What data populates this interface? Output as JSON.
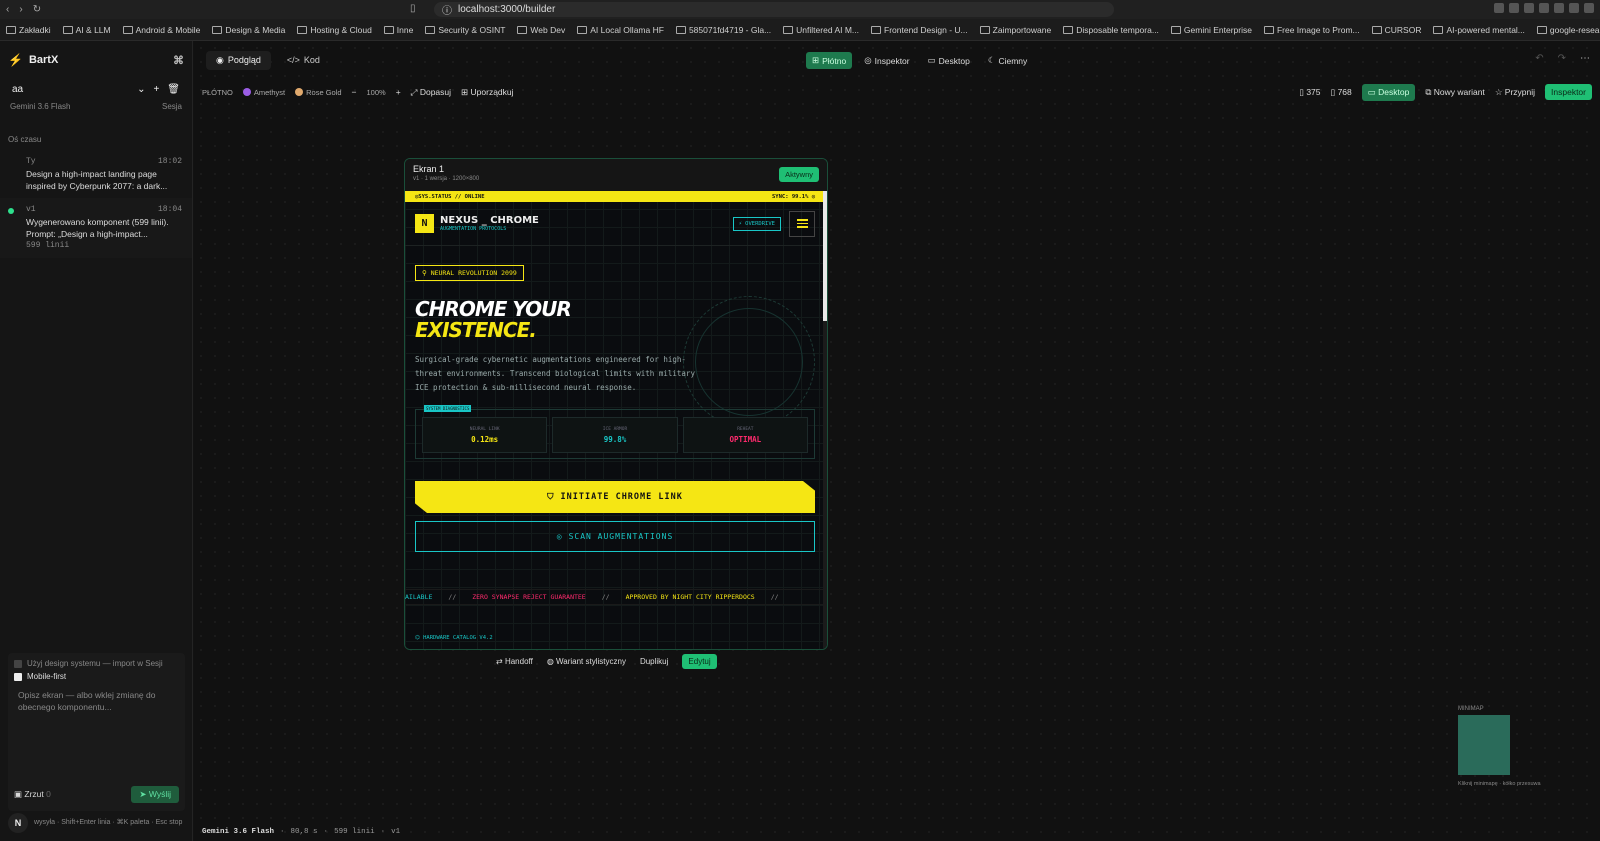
{
  "browser": {
    "url": "localhost:3000/builder",
    "bookmarks": [
      "Zakładki",
      "AI & LLM",
      "Android & Mobile",
      "Design & Media",
      "Hosting & Cloud",
      "Inne",
      "Security & OSINT",
      "Web Dev",
      "AI Local Ollama HF",
      "585071fd4719 - Gla...",
      "Unfiltered AI M...",
      "Frontend Design - U...",
      "Zaimportowane",
      "Disposable tempora...",
      "Gemini Enterprise",
      "Free Image to Prom...",
      "CURSOR",
      "AI-powered mental...",
      "google-research-da..."
    ]
  },
  "sidebar": {
    "app_name": "BartX",
    "cmd_symbol": "⌘",
    "session_value": "aa",
    "model": "Gemini 3.6 Flash",
    "session_label": "Sesja",
    "timeline_title": "Oś czasu",
    "timeline": [
      {
        "who": "Ty",
        "time": "18:02",
        "text": "Design a high-impact landing page inspired by Cyberpunk 2077: a dark..."
      },
      {
        "who": "v1",
        "time": "18:04",
        "text": "Wygenerowano komponent (599 linii). Prompt: „Design a high-impact...",
        "meta": "599 linii"
      }
    ],
    "use_design_system": "Użyj design systemu — import w Sesji",
    "mobile_first": "Mobile-first",
    "prompt_placeholder": "Opisz ekran — albo wklej zmianę do obecnego komponentu...",
    "snapshot_label": "Zrzut",
    "snapshot_count": "0",
    "send_label": "Wyślij",
    "footer_hint": "wysyła · Shift+Enter linia · ⌘K paleta · Esc stop",
    "avatar_letter": "N"
  },
  "topbar": {
    "tab_preview": "Podgląd",
    "tab_code": "Kod",
    "canvas": "Płótno",
    "inspector": "Inspektor",
    "desktop": "Desktop",
    "dark": "Ciemny"
  },
  "toolbar": {
    "canvas_label": "PŁÓTNO",
    "theme1": "Amethyst",
    "theme1_color": "#9b5de5",
    "theme2": "Rose Gold",
    "theme2_color": "#e0a96d",
    "zoom": "100%",
    "fit": "Dopasuj",
    "arrange": "Uporządkuj",
    "w375": "375",
    "w768": "768",
    "desktop": "Desktop",
    "new_variant": "Nowy wariant",
    "pin": "Przypnij",
    "inspector": "Inspektor"
  },
  "frame": {
    "title": "Ekran 1",
    "subtitle": "v1 · 1 wersja · 1200×800",
    "status": "Aktywny",
    "actions": [
      "Handoff",
      "Wariant stylistyczny",
      "Duplikuj",
      "Edytuj"
    ]
  },
  "site": {
    "sys_status": "◎SYS.STATUS // ONLINE",
    "sync": "SYNC: 99.1% ◎",
    "logo_letter": "N",
    "brand": "NEXUS _ CHROME",
    "brand_sub": "AUGMENTATION PROTOCOLS",
    "overdrive": "⚡ OVERDRIVE",
    "badge": "NEURAL REVOLUTION 2099",
    "hero_line1": "CHROME YOUR",
    "hero_line2": "EXISTENCE.",
    "description": "Surgical-grade cybernetic augmentations engineered for high-threat environments. Transcend biological limits with military ICE protection & sub-millisecond neural response.",
    "diag_label": "SYSTEM DIAGNOSTICS",
    "stats": [
      {
        "key": "NEURAL LINK",
        "value": "0.12ms",
        "color": "#f5e614"
      },
      {
        "key": "ICE ARMOR",
        "value": "99.8%",
        "color": "#19c6c6"
      },
      {
        "key": "REHEAT",
        "value": "OPTIMAL",
        "color": "#ff2a6d"
      }
    ],
    "cta_primary": "INITIATE CHROME LINK",
    "cta_secondary": "SCAN AUGMENTATIONS",
    "marquee": [
      "AILABLE",
      "//",
      "ZERO SYNAPSE REJECT GUARANTEE",
      "//",
      "APPROVED BY NIGHT CITY RIPPERDOCS",
      "//"
    ],
    "catalog": "HARDWARE CATALOG V4.2"
  },
  "minimap": {
    "label": "MINIMAP",
    "hint": "Kliknij minimapę · kółko przesuwa"
  },
  "statusbar": {
    "model": "Gemini 3.6 Flash",
    "time": "80,8 s",
    "lines": "599 linii",
    "version": "v1"
  },
  "colors": {
    "accent": "#1fbf74",
    "yellow": "#f5e614",
    "cyan": "#19c6c6",
    "pink": "#ff2a6d"
  }
}
